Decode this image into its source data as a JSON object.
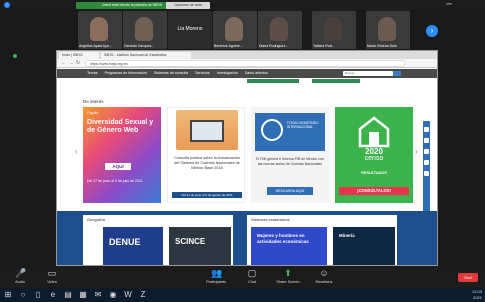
{
  "zoom_top": {
    "share_banner": "Usted está viendo la pantalla de INEGI",
    "share_btn": "Opciones de vista",
    "view_label": "Ver"
  },
  "video_tiles": [
    {
      "name": "Angelica Ayala Aya...",
      "kind": "person",
      "color": "#8a6d5a"
    },
    {
      "name": "Gerardo Vázquez...",
      "kind": "person",
      "color": "#6d5f52"
    },
    {
      "name": "Lia Moreno",
      "kind": "plain"
    },
    {
      "name": "Berenice Aguirre...",
      "kind": "person",
      "color": "#7a6a5e"
    },
    {
      "name": "Diana Rodriguez...",
      "kind": "person",
      "color": "#5d4f47"
    },
    {
      "name": "Tatiana Ruiz...",
      "kind": "person",
      "color": "#4a3f3a"
    },
    {
      "name": "Maria Ximena Soto",
      "kind": "person",
      "color": "#6a5a50"
    }
  ],
  "browser": {
    "tabs": [
      "Inicio | INEGI",
      "INEGI - Instituto Nacional de Estadística"
    ],
    "url": "https://www.inegi.org.mx"
  },
  "site": {
    "nav_links": [
      "Temas",
      "Programas de Información",
      "Sistemas de consulta",
      "Servicios",
      "Investigación",
      "Datos abiertos"
    ],
    "search_placeholder": "Buscar",
    "section_title": "De interés",
    "carousel": {
      "card1": {
        "top": "Orgullo",
        "title": "Diversidad Sexual y de Género Web",
        "cta": "AQUÍ",
        "dates": "Del 27 de junio al 9 de julio de 2021"
      },
      "card2": {
        "text": "Consulta pública sobre la Actualización del Sistema de Cuentas Nacionales de México Base 2018",
        "bar": "Del 21 de junio al 9 de agosto de 2021"
      },
      "card3": {
        "logo_text": "FONDO MONETARIO INTERNACIONAL",
        "text": "El FMI genera e informa PIB de México con las nuevas series de Cuentas Nacionales",
        "button": "DESCARGA AQUÍ"
      },
      "card4": {
        "year": "2020",
        "censo": "censo",
        "results": "RESULTADOS",
        "cta": "¡CONSÚLTALOS!"
      }
    },
    "lower": {
      "col1_title": "Geografía",
      "col2_title": "Sistemas estadísticos",
      "tiles": {
        "denue": "DENUE",
        "scince": "SCINCE",
        "mujeres": "Mujeres y hombres en actividades económicas",
        "mineria": "Minería"
      }
    }
  },
  "zoom_toolbar": {
    "items": [
      {
        "label": "Audio",
        "icon": "microphone-muted-icon"
      },
      {
        "label": "Video",
        "icon": "video-camera-icon"
      },
      {
        "label": "Participants",
        "icon": "participants-icon"
      },
      {
        "label": "Chat",
        "icon": "chat-icon"
      },
      {
        "label": "Share Screen",
        "icon": "share-screen-icon"
      },
      {
        "label": "Reactions",
        "icon": "reactions-icon"
      }
    ],
    "end_label": "End"
  },
  "taskbar": {
    "time": "12:03",
    "date": "2021"
  }
}
